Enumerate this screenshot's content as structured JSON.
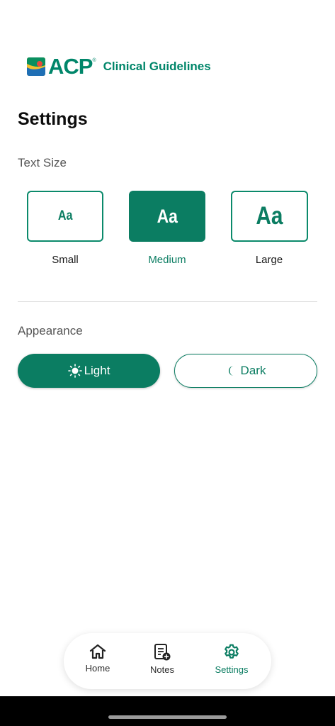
{
  "header": {
    "logo_text": "ACP",
    "trademark": "®",
    "subtitle": "Clinical Guidelines"
  },
  "page": {
    "title": "Settings"
  },
  "text_size": {
    "label": "Text Size",
    "glyph": "Aa",
    "options": [
      {
        "label": "Small",
        "selected": false
      },
      {
        "label": "Medium",
        "selected": true
      },
      {
        "label": "Large",
        "selected": false
      }
    ]
  },
  "appearance": {
    "label": "Appearance",
    "options": [
      {
        "label": "Light",
        "icon": "sun-icon",
        "selected": true
      },
      {
        "label": "Dark",
        "icon": "moon-icon",
        "selected": false
      }
    ]
  },
  "bottom_nav": {
    "items": [
      {
        "label": "Home",
        "icon": "home-icon",
        "active": false
      },
      {
        "label": "Notes",
        "icon": "notes-add-icon",
        "active": false
      },
      {
        "label": "Settings",
        "icon": "gear-icon",
        "active": true
      }
    ]
  },
  "colors": {
    "accent": "#0b7d62",
    "brand": "#00866a",
    "background": "#ffffff",
    "system_bar": "#000000"
  }
}
